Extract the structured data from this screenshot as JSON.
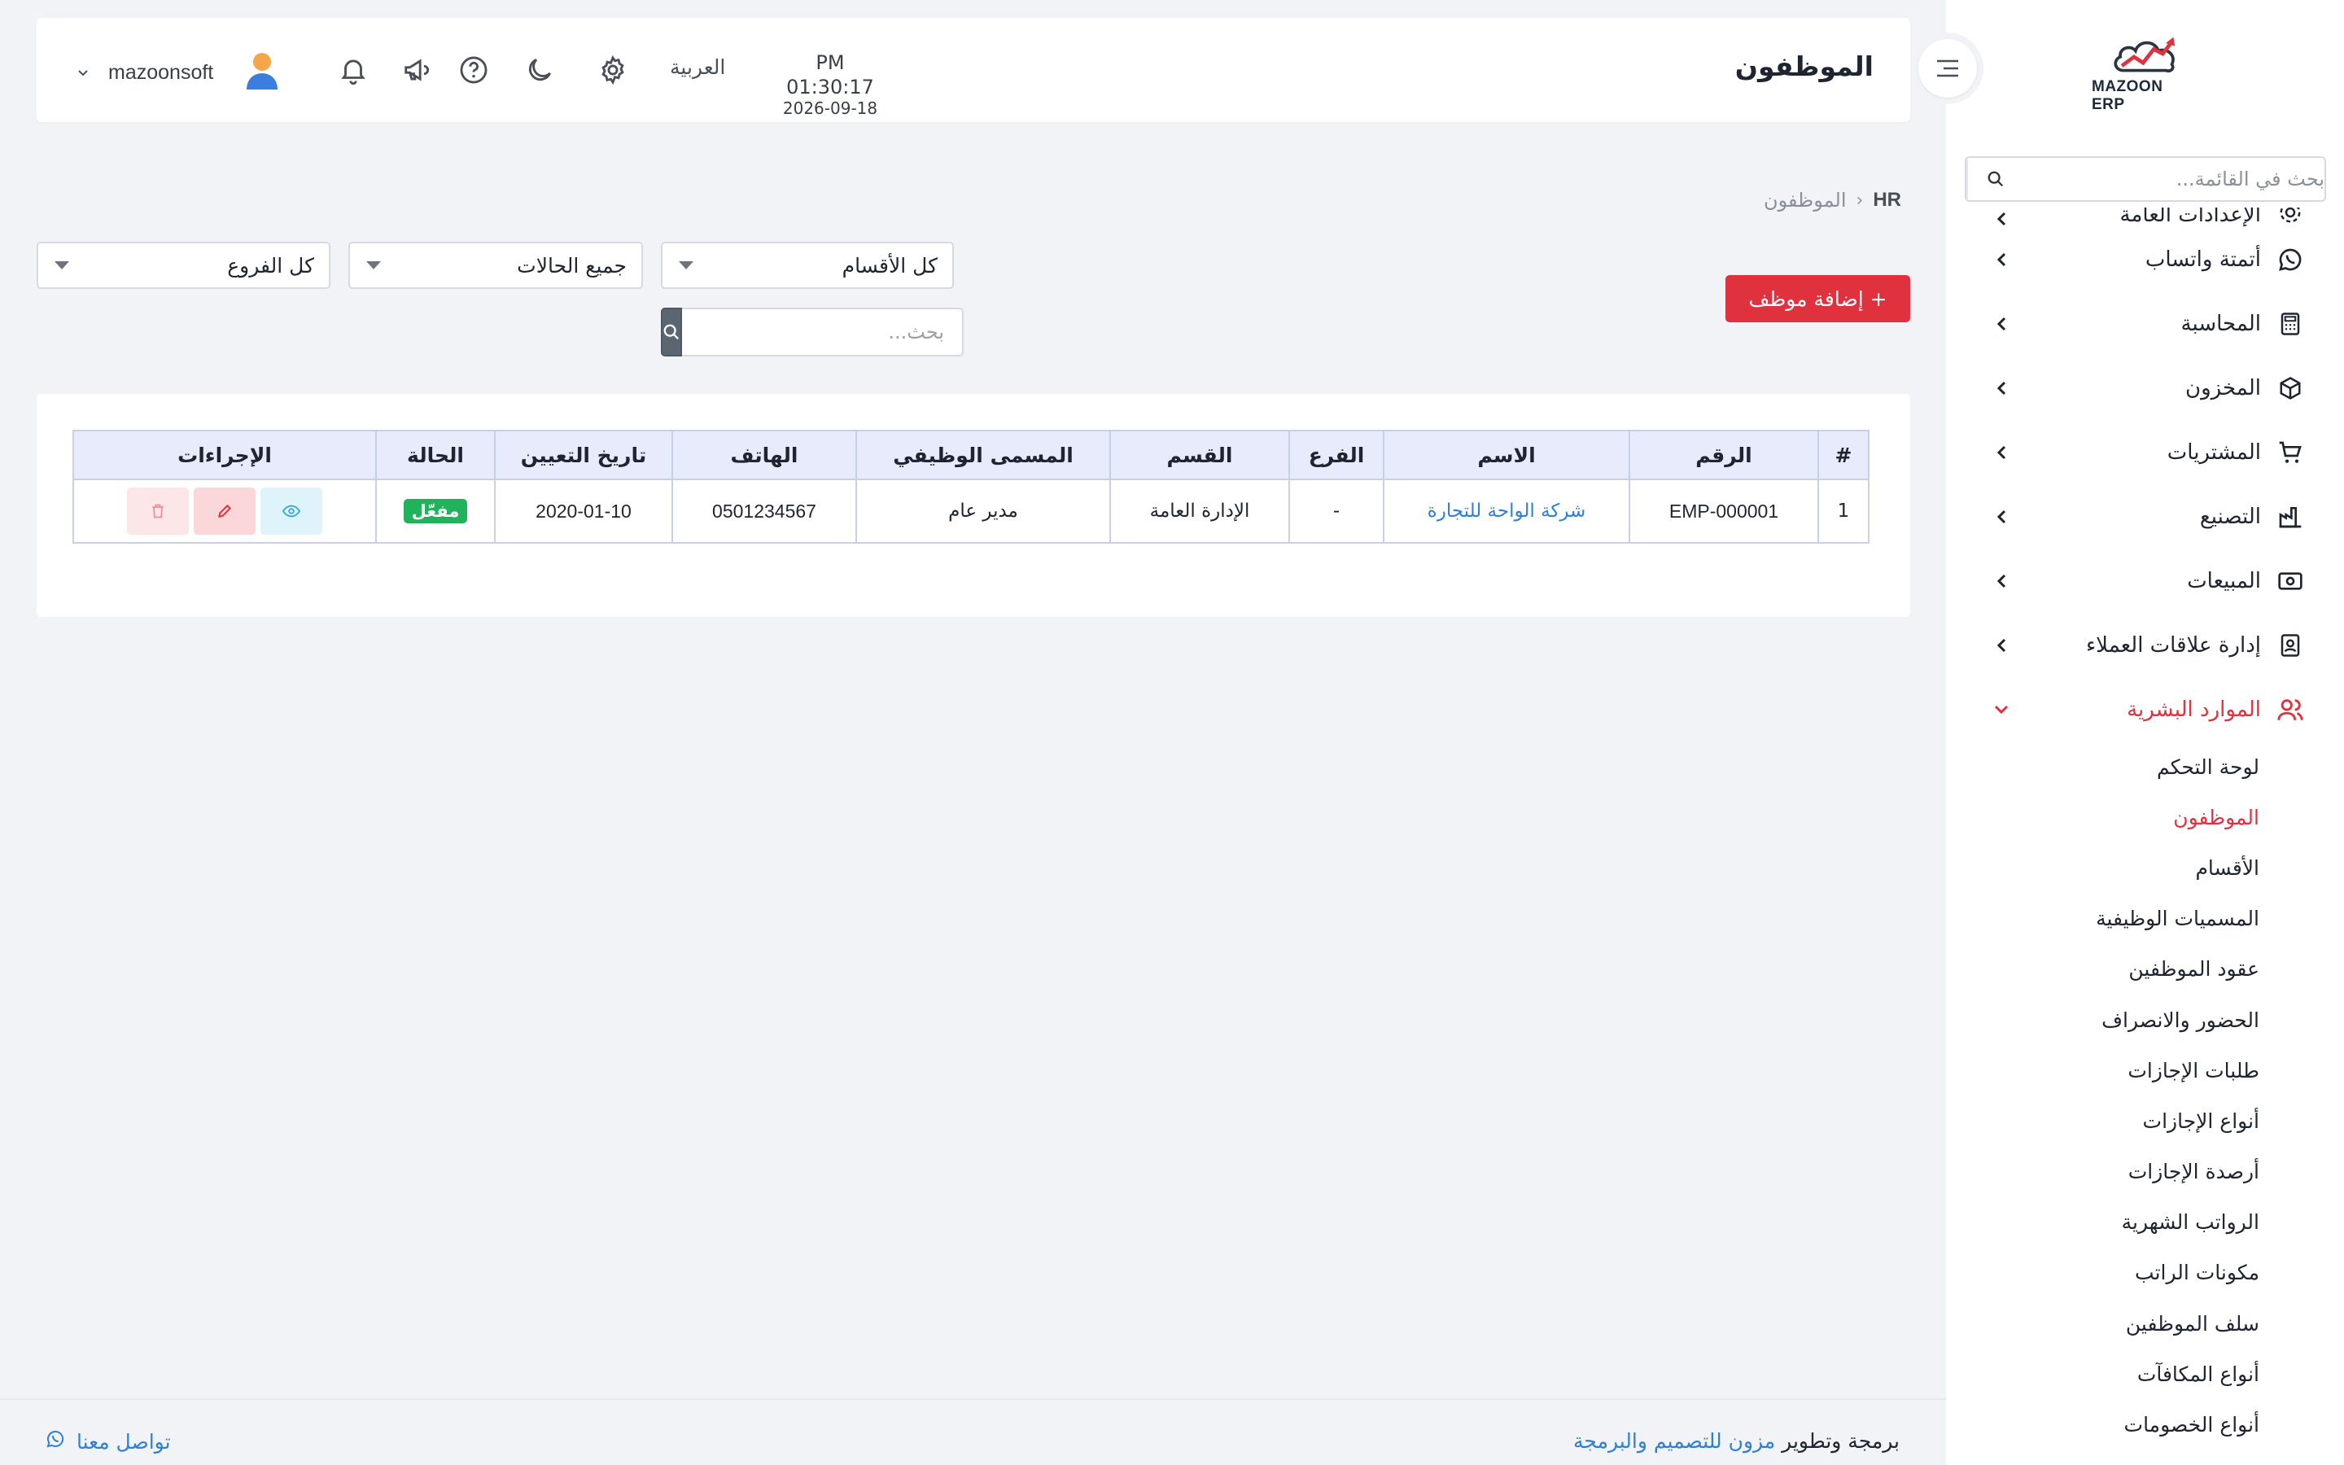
{
  "sidebar": {
    "logo_text": "MAZOON ERP",
    "search_placeholder": "بحث في القائمة...",
    "items": [
      {
        "label": "الإعدادات العامة",
        "icon": "gear-icon"
      },
      {
        "label": "أتمتة واتساب",
        "icon": "whatsapp-icon"
      },
      {
        "label": "المحاسبة",
        "icon": "calculator-icon"
      },
      {
        "label": "المخزون",
        "icon": "box-icon"
      },
      {
        "label": "المشتريات",
        "icon": "cart-icon"
      },
      {
        "label": "التصنيع",
        "icon": "factory-icon"
      },
      {
        "label": "المبيعات",
        "icon": "cash-icon"
      },
      {
        "label": "إدارة علاقات العملاء",
        "icon": "contacts-icon"
      },
      {
        "label": "الموارد البشرية",
        "icon": "users-icon"
      }
    ],
    "hr_submenu": [
      "لوحة التحكم",
      "الموظفون",
      "الأقسام",
      "المسميات الوظيفية",
      "عقود الموظفين",
      "الحضور والانصراف",
      "طلبات الإجازات",
      "أنواع الإجازات",
      "أرصدة الإجازات",
      "الرواتب الشهرية",
      "مكونات الراتب",
      "سلف الموظفين",
      "أنواع المكافآت",
      "أنواع الخصومات"
    ]
  },
  "header": {
    "title": "الموظفون",
    "time": "PM 01:30:17",
    "date": "2026-09-18",
    "language": "العربية",
    "username": "mazoonsoft"
  },
  "breadcrumb": {
    "root": "HR",
    "separator": "‹",
    "current": "الموظفون"
  },
  "toolbar": {
    "add_button": "+ إضافة موظف",
    "department_filter": "كل الأقسام",
    "status_filter": "جميع الحالات",
    "branch_filter": "كل الفروع",
    "search_placeholder": "بحث..."
  },
  "table": {
    "headers": {
      "num": "#",
      "code": "الرقم",
      "name": "الاسم",
      "branch": "الفرع",
      "department": "القسم",
      "job_title": "المسمى الوظيفي",
      "phone": "الهاتف",
      "hire_date": "تاريخ التعيين",
      "status": "الحالة",
      "actions": "الإجراءات"
    },
    "rows": [
      {
        "num": "1",
        "code": "EMP-000001",
        "name": "شركة الواحة للتجارة",
        "branch": "-",
        "department": "الإدارة العامة",
        "job_title": "مدير عام",
        "phone": "0501234567",
        "hire_date": "2020-01-10",
        "status": "مفعّل"
      }
    ]
  },
  "footer": {
    "contact": "تواصل معنا",
    "credit_prefix": "برمجة وتطوير",
    "credit_brand": "مزون للتصميم والبرمجة"
  },
  "colors": {
    "accent": "#e0323e",
    "link": "#2f7fd6",
    "active_badge": "#21b35c",
    "table_header": "#e7ebfb"
  }
}
